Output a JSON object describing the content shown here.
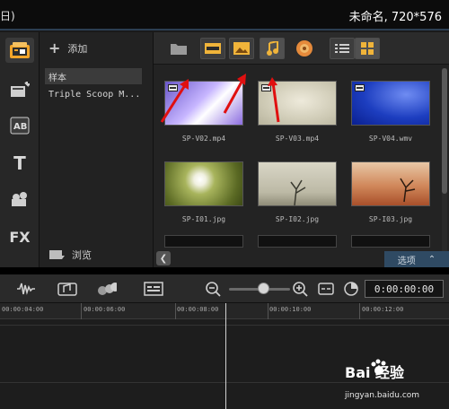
{
  "titlebar": {
    "left_fragment": "日)",
    "project_title": "未命名, 720*576"
  },
  "left_rail": {
    "items": [
      {
        "icon": "media-library-icon",
        "active": true
      },
      {
        "icon": "instant-project-icon"
      },
      {
        "icon": "transition-icon",
        "text": "AB"
      },
      {
        "icon": "title-icon",
        "text": "T"
      },
      {
        "icon": "graphics-icon"
      },
      {
        "icon": "filter-icon",
        "text": "FX"
      }
    ]
  },
  "library": {
    "add_label": "添加",
    "items": [
      "样本",
      "Triple Scoop M..."
    ],
    "browse_label": "浏览"
  },
  "media": {
    "toolbar_icons": [
      "folder-icon",
      "show-video-icon",
      "show-photo-icon",
      "show-audio-icon",
      "sort-icon",
      "list-view-icon",
      "thumbnail-view-icon"
    ],
    "thumbnails": [
      {
        "label": "SP-V02.mp4",
        "type": "video",
        "color": "#8a7bd6"
      },
      {
        "label": "SP-V03.mp4",
        "type": "video",
        "color": "#d7d3bf"
      },
      {
        "label": "SP-V04.wmv",
        "type": "video",
        "color": "#1c3fb8"
      },
      {
        "label": "SP-I01.jpg",
        "type": "image",
        "color": "#6b7a2e"
      },
      {
        "label": "SP-I02.jpg",
        "type": "image",
        "color": "#bdbaa8"
      },
      {
        "label": "SP-I03.jpg",
        "type": "image",
        "color": "#c06a3c"
      }
    ],
    "options_label": "选项"
  },
  "timeline": {
    "toolbar_icons": [
      "sound-mixer-icon",
      "auto-music-icon",
      "motion-track-icon",
      "subtitle-editor-icon",
      "zoom-out-icon",
      "zoom-slider",
      "zoom-in-icon",
      "fit-project-icon",
      "duration-icon"
    ],
    "timecode": "0:00:00:00",
    "ruler_ticks": [
      "00:00:04:00",
      "00:00:06:00",
      "00:00:08:00",
      "00:00:10:00",
      "00:00:12:00"
    ]
  },
  "watermark": {
    "main": "Bai 经验",
    "sub": "jingyan.baidu.com"
  },
  "colors": {
    "annotation_arrow": "#e01010",
    "options_bg": "#2f4a63"
  }
}
